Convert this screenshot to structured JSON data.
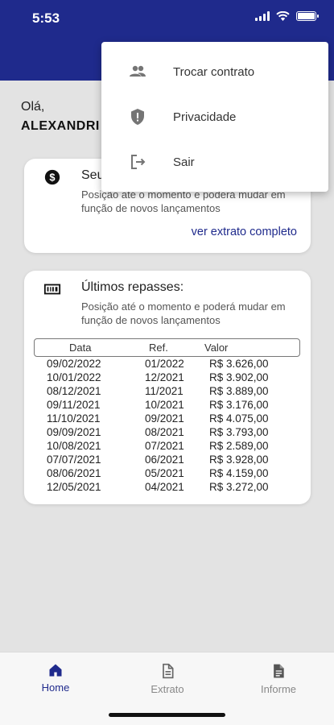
{
  "status_bar": {
    "time": "5:53"
  },
  "greeting": {
    "hello": "Olá,",
    "name": "ALEXANDRI"
  },
  "balance_card": {
    "icon": "dollar-circle-icon",
    "title": "Seu",
    "subtitle": "Posição até o momento e poderá mudar em função de novos lançamentos",
    "link": "ver extrato completo"
  },
  "transfers_card": {
    "icon": "barcode-icon",
    "title": "Últimos repasses:",
    "subtitle": "Posição até o momento e poderá mudar em função de novos lançamentos",
    "columns": [
      "Data",
      "Ref.",
      "Valor"
    ],
    "rows": [
      [
        "09/02/2022",
        "01/2022",
        "R$ 3.626,00"
      ],
      [
        "10/01/2022",
        "12/2021",
        "R$ 3.902,00"
      ],
      [
        "08/12/2021",
        "11/2021",
        "R$ 3.889,00"
      ],
      [
        "09/11/2021",
        "10/2021",
        "R$ 3.176,00"
      ],
      [
        "11/10/2021",
        "09/2021",
        "R$ 4.075,00"
      ],
      [
        "09/09/2021",
        "08/2021",
        "R$ 3.793,00"
      ],
      [
        "10/08/2021",
        "07/2021",
        "R$ 2.589,00"
      ],
      [
        "07/07/2021",
        "06/2021",
        "R$ 3.928,00"
      ],
      [
        "08/06/2021",
        "05/2021",
        "R$ 4.159,00"
      ],
      [
        "12/05/2021",
        "04/2021",
        "R$ 3.272,00"
      ]
    ]
  },
  "menu": {
    "items": [
      {
        "label": "Trocar contrato",
        "icon": "people-icon"
      },
      {
        "label": "Privacidade",
        "icon": "shield-icon"
      },
      {
        "label": "Sair",
        "icon": "logout-icon"
      }
    ]
  },
  "bottom_nav": {
    "items": [
      {
        "label": "Home",
        "icon": "home-icon",
        "active": true
      },
      {
        "label": "Extrato",
        "icon": "document-outline-icon",
        "active": false
      },
      {
        "label": "Informe",
        "icon": "document-filled-icon",
        "active": false
      }
    ]
  },
  "colors": {
    "primary": "#1f2a8c",
    "background": "#e3e3e3",
    "card": "#ffffff"
  }
}
